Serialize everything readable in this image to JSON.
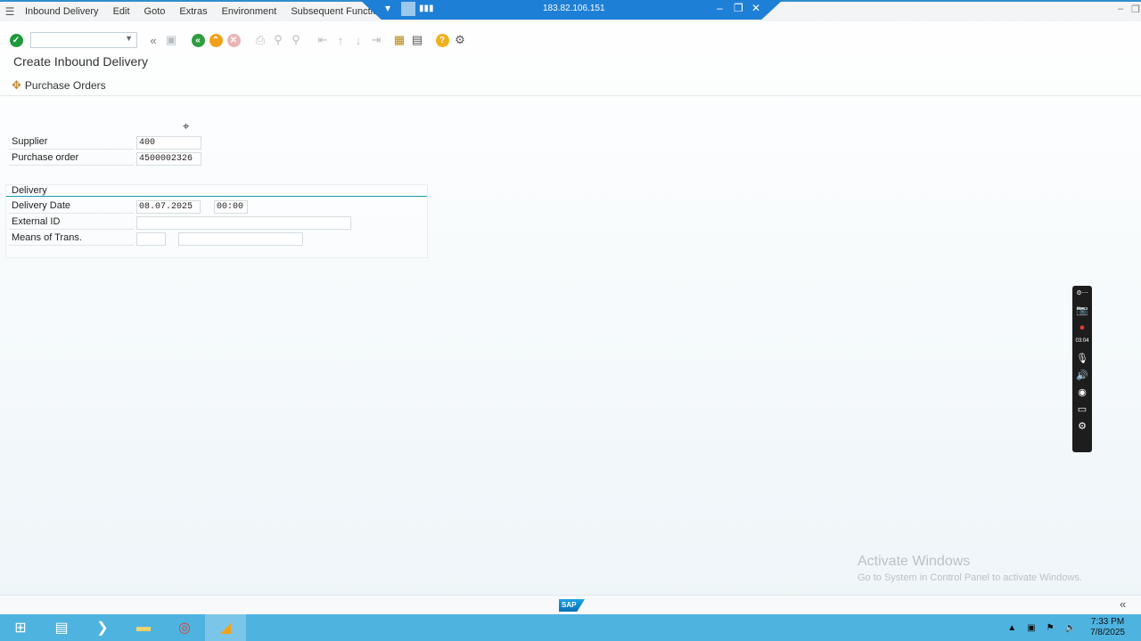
{
  "menu": {
    "items": [
      "Inbound Delivery",
      "Edit",
      "Goto",
      "Extras",
      "Environment",
      "Subsequent Functions"
    ]
  },
  "rdp": {
    "host": "183.82.106.151"
  },
  "page": {
    "title": "Create Inbound Delivery"
  },
  "appbar": {
    "purchase_orders_label": "Purchase Orders"
  },
  "form": {
    "supplier_label": "Supplier",
    "supplier_value": "400",
    "purchase_order_label": "Purchase order",
    "purchase_order_value": "4500002326"
  },
  "delivery": {
    "section_title": "Delivery",
    "delivery_date_label": "Delivery Date",
    "delivery_date_value": "08.07.2025",
    "delivery_time_value": "00:00",
    "external_id_label": "External ID",
    "external_id_value": "",
    "means_of_trans_label": "Means of Trans.",
    "means_of_trans_type": "",
    "means_of_trans_id": ""
  },
  "recorder": {
    "time": "03:04"
  },
  "watermark": {
    "title": "Activate Windows",
    "subtitle": "Go to System in Control Panel to activate Windows."
  },
  "statusbar": {
    "logo_text": "SAP"
  },
  "taskbar": {
    "time": "7:33 PM",
    "date": "7/8/2025"
  },
  "colors": {
    "accent": "#2f8fcf",
    "rdp_bar": "#1e7fd6",
    "taskbar": "#4fb3e0",
    "section_line": "#1a9bb0",
    "enter_green": "#1e9a3c",
    "back_green": "#2e9c3f",
    "exit_orange": "#f0a21c",
    "cancel_red": "#e15a5a",
    "help_yellow": "#f2b01e"
  }
}
